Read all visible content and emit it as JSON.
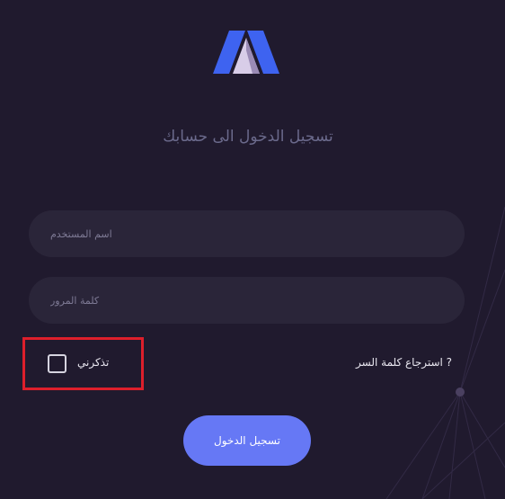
{
  "login_form": {
    "title": "تسجيل الدخول الى حسابك",
    "username_placeholder": "اسم المستخدم",
    "password_placeholder": "كلمة المرور",
    "remember_label": "تذكرني",
    "remember_checked": false,
    "forgot_label": "? استرجاع كلمة السر",
    "submit_label": "تسجيل الدخول"
  },
  "colors": {
    "background": "#201a2e",
    "field_background": "#2a2539",
    "title": "#6b6a8c",
    "button": "#6678f5",
    "highlight": "#dd1f2b",
    "logo_blue": "#3e63f0"
  },
  "icons": {
    "logo": "stylized-m-logo",
    "network_decoration": "network-lines-icon"
  }
}
